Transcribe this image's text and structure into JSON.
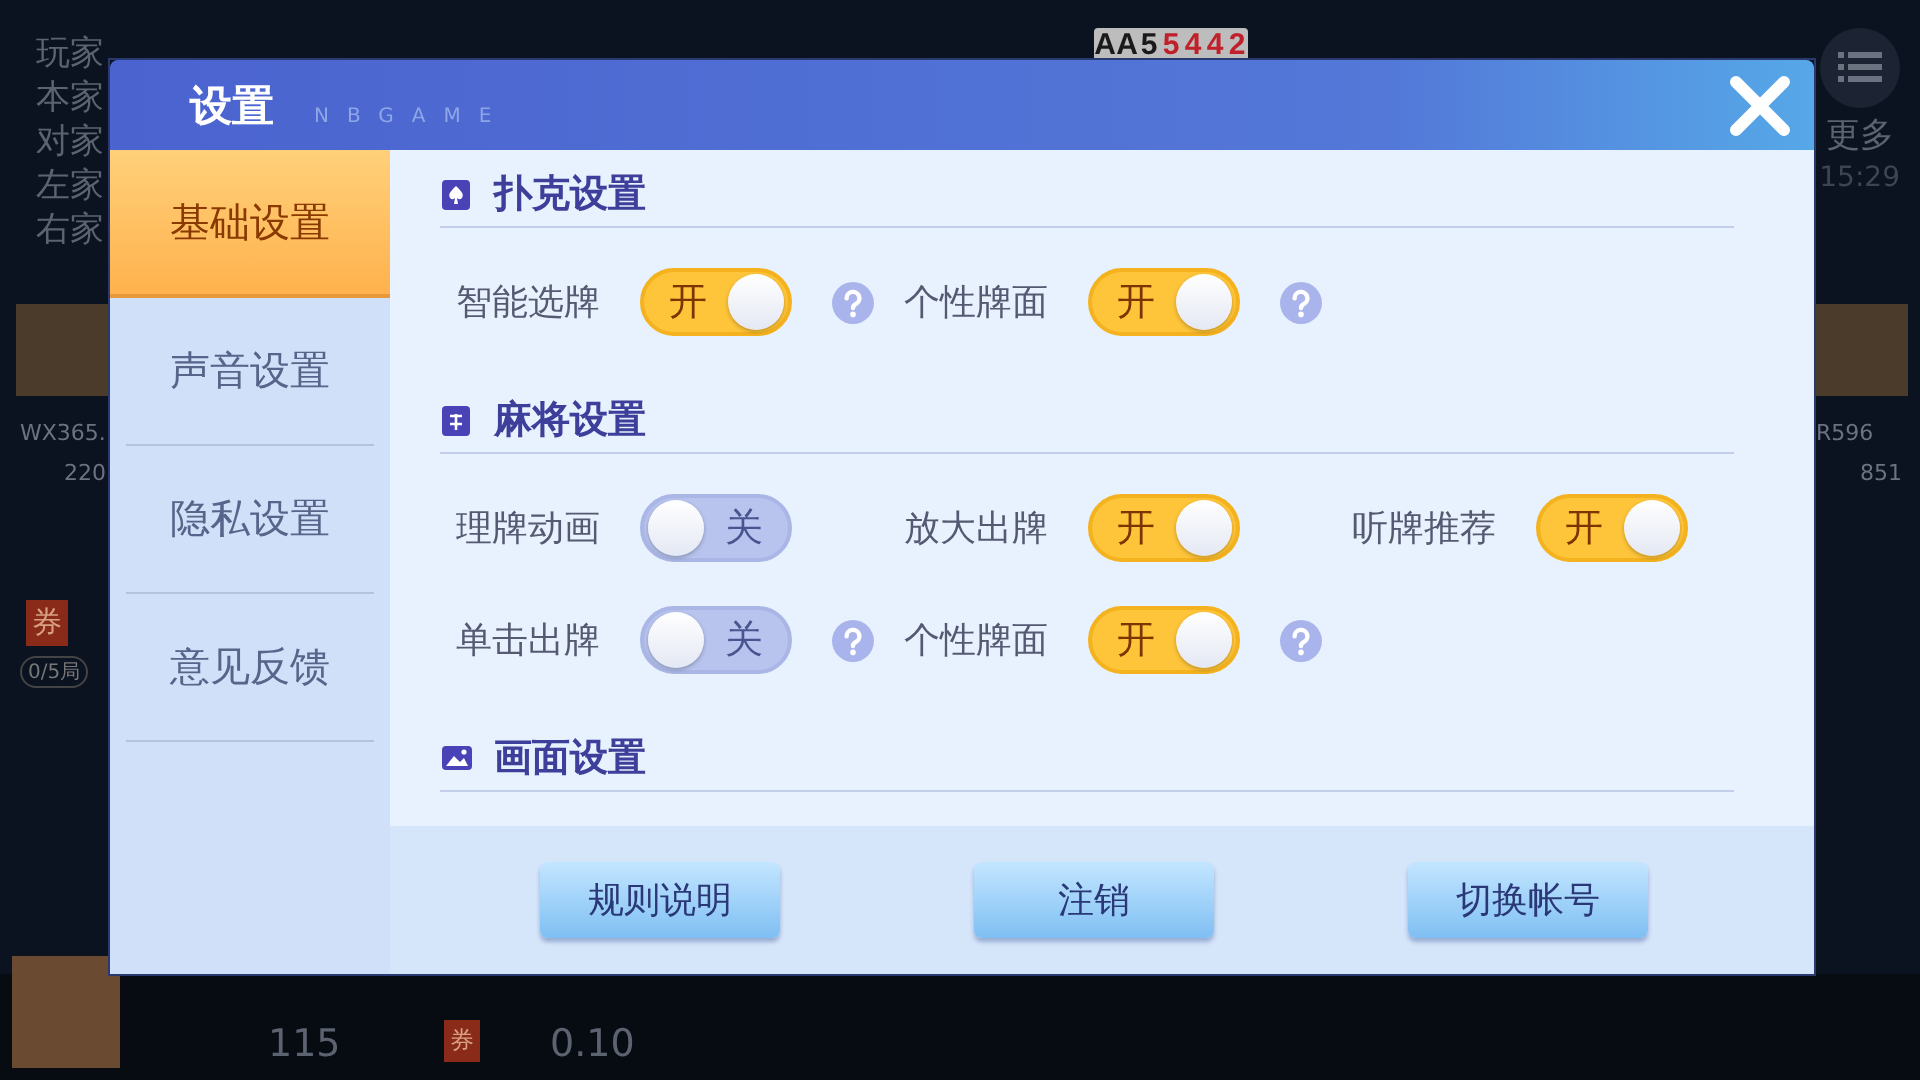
{
  "background": {
    "scoreboard_header": "玩家",
    "scoreboard": [
      "本家",
      "对家",
      "左家",
      "右家"
    ],
    "cards": [
      {
        "rank": "A",
        "color": "#1a1a1a"
      },
      {
        "rank": "A",
        "color": "#1a1a1a"
      },
      {
        "rank": "5",
        "color": "#1a1a1a"
      },
      {
        "rank": "5",
        "color": "#c0202a"
      },
      {
        "rank": "4",
        "color": "#c0202a"
      },
      {
        "rank": "4",
        "color": "#c0202a"
      },
      {
        "rank": "2",
        "color": "#c0202a"
      }
    ],
    "players": [
      {
        "name": "WX365.",
        "coins": "220"
      },
      {
        "name": "R596",
        "coins": "851"
      }
    ],
    "voucher": {
      "badge": "券",
      "progress": "0/5局"
    },
    "more": "更多",
    "time": "15:29",
    "bottom": {
      "coins": "115",
      "voucher_badge": "券",
      "voucher_value": "0.10"
    }
  },
  "dialog": {
    "title": "设置",
    "brand": "NBGAME",
    "tabs": [
      {
        "label": "基础设置",
        "selected": true
      },
      {
        "label": "声音设置",
        "selected": false
      },
      {
        "label": "隐私设置",
        "selected": false
      },
      {
        "label": "意见反馈",
        "selected": false
      }
    ],
    "sections": [
      {
        "title": "扑克设置",
        "kind": "poker",
        "rows": [
          [
            {
              "label": "智能选牌",
              "on": true,
              "toggle_text": "开",
              "help": true
            },
            {
              "label": "个性牌面",
              "on": true,
              "toggle_text": "开",
              "help": true
            }
          ]
        ]
      },
      {
        "title": "麻将设置",
        "kind": "mahjong",
        "rows": [
          [
            {
              "label": "理牌动画",
              "on": false,
              "toggle_text": "关",
              "help": false
            },
            {
              "label": "放大出牌",
              "on": true,
              "toggle_text": "开",
              "help": false
            },
            {
              "label": "听牌推荐",
              "on": true,
              "toggle_text": "开",
              "help": false
            }
          ],
          [
            {
              "label": "单击出牌",
              "on": false,
              "toggle_text": "关",
              "help": true
            },
            {
              "label": "个性牌面",
              "on": true,
              "toggle_text": "开",
              "help": true
            }
          ]
        ]
      },
      {
        "title": "画面设置",
        "kind": "picture"
      }
    ],
    "buttons": [
      "规则说明",
      "注销",
      "切换帐号"
    ]
  }
}
